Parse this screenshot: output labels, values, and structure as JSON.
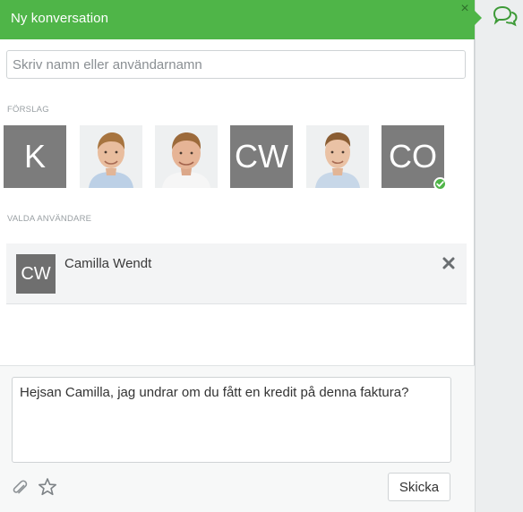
{
  "header": {
    "title": "Ny konversation",
    "close_glyph": "×",
    "accent_color": "#4fb548"
  },
  "search": {
    "placeholder": "Skriv namn eller användarnamn",
    "value": ""
  },
  "suggestions": {
    "label": "FÖRSLAG",
    "items": [
      {
        "kind": "initials",
        "text": "K"
      },
      {
        "kind": "photo",
        "icon": "person-photo"
      },
      {
        "kind": "photo",
        "icon": "person-photo"
      },
      {
        "kind": "initials",
        "text": "CW"
      },
      {
        "kind": "photo",
        "icon": "person-photo"
      },
      {
        "kind": "initials",
        "text": "CO",
        "status": "online-check-icon"
      }
    ]
  },
  "selected": {
    "label": "VALDA ANVÄNDARE",
    "users": [
      {
        "initials": "CW",
        "name": "Camilla Wendt",
        "remove_icon": "close-icon"
      }
    ]
  },
  "composer": {
    "message": "Hejsan Camilla, jag undrar om du fått en kredit på denna faktura?",
    "attach_icon": "paperclip-icon",
    "favorite_icon": "star-icon",
    "send_label": "Skicka"
  },
  "rail": {
    "chat_icon": "chat-bubbles-icon"
  }
}
